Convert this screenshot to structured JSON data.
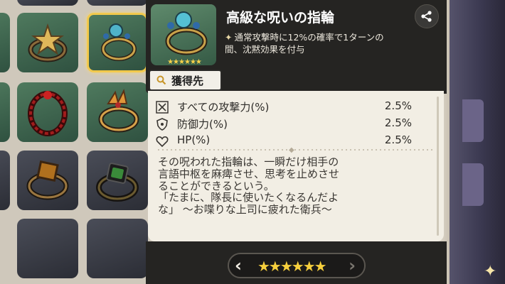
{
  "item": {
    "title": "高級な呪いの指輪",
    "effect": "通常攻撃時に12%の確率で1ターンの間、沈黙効果を付与",
    "effect_marker": "✦",
    "thumb_stars": "★★★★★★",
    "obtain_label": "獲得先"
  },
  "stats": [
    {
      "icon": "sword-crossed-icon",
      "name": "すべての攻撃力(%)",
      "value": "2.5%"
    },
    {
      "icon": "shield-icon",
      "name": "防御力(%)",
      "value": "2.5%"
    },
    {
      "icon": "heart-icon",
      "name": "HP(%)",
      "value": "2.5%"
    }
  ],
  "lore_lines": [
    "その呪われた指輪は、一瞬だけ相手の",
    "言語中枢を麻痺させ、思考を止めさせ",
    "ることができるという。",
    "「たまに、隊長に使いたくなるんだよ",
    "な」 〜お喋りな上司に疲れた衛兵〜"
  ],
  "rarity": {
    "stars": "★★★★★★",
    "prev": "‹",
    "next": "›",
    "star_color": "#f6cf3d"
  },
  "colors": {
    "selected_border": "#f2c94c",
    "panel": "#f2eee4",
    "header": "#252422"
  },
  "inventory_slots": [
    {
      "name": "ring-star-gold",
      "selected": false
    },
    {
      "name": "ring-blue-gem",
      "selected": true
    },
    {
      "name": "ring-thorn-red",
      "selected": false
    },
    {
      "name": "ring-flame-gold",
      "selected": false
    },
    {
      "name": "ring-square-amber",
      "selected": false
    },
    {
      "name": "ring-green-emerald",
      "selected": false
    }
  ]
}
